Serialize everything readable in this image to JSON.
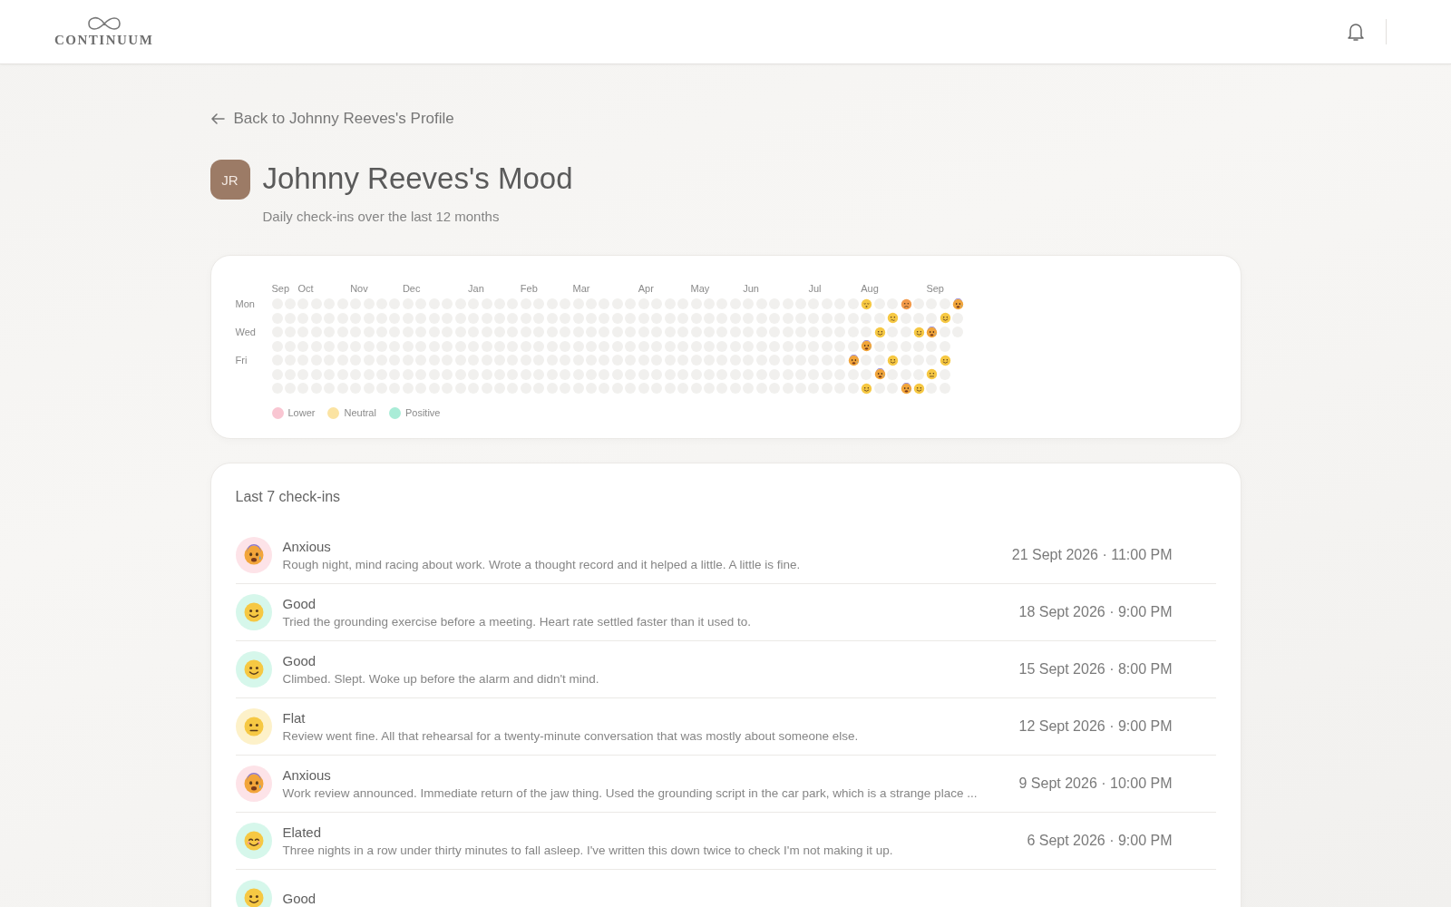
{
  "header": {
    "logo": "CONTINUUM"
  },
  "back_link": "Back to Johnny Reeves's Profile",
  "profile": {
    "initials": "JR",
    "title": "Johnny Reeves's Mood",
    "subtitle": "Daily check-ins over the last 12 months"
  },
  "heatmap": {
    "day_labels": [
      {
        "kind": "label",
        "label": "Mon"
      },
      {
        "kind": "blank"
      },
      {
        "kind": "label",
        "label": "Wed"
      },
      {
        "kind": "blank"
      },
      {
        "kind": "label",
        "label": "Fri"
      },
      {
        "kind": "blank"
      },
      {
        "kind": "blank"
      }
    ],
    "weeks": [
      {
        "kind": "blank",
        "month": "Sep"
      },
      {
        "kind": "blank"
      },
      {
        "kind": "blank",
        "month": "Oct"
      },
      {
        "kind": "blank"
      },
      {
        "kind": "blank"
      },
      {
        "kind": "blank"
      },
      {
        "kind": "blank",
        "month": "Nov"
      },
      {
        "kind": "blank"
      },
      {
        "kind": "blank"
      },
      {
        "kind": "blank"
      },
      {
        "kind": "blank",
        "month": "Dec"
      },
      {
        "kind": "blank"
      },
      {
        "kind": "blank"
      },
      {
        "kind": "blank"
      },
      {
        "kind": "blank"
      },
      {
        "kind": "blank",
        "month": "Jan"
      },
      {
        "kind": "blank"
      },
      {
        "kind": "blank"
      },
      {
        "kind": "blank"
      },
      {
        "kind": "blank",
        "month": "Feb"
      },
      {
        "kind": "blank"
      },
      {
        "kind": "blank"
      },
      {
        "kind": "blank"
      },
      {
        "kind": "blank",
        "month": "Mar"
      },
      {
        "kind": "blank"
      },
      {
        "kind": "blank"
      },
      {
        "kind": "blank"
      },
      {
        "kind": "blank"
      },
      {
        "kind": "blank",
        "month": "Apr"
      },
      {
        "kind": "blank"
      },
      {
        "kind": "blank"
      },
      {
        "kind": "blank"
      },
      {
        "kind": "blank",
        "month": "May"
      },
      {
        "kind": "blank"
      },
      {
        "kind": "blank"
      },
      {
        "kind": "blank"
      },
      {
        "kind": "blank",
        "month": "Jun"
      },
      {
        "kind": "blank"
      },
      {
        "kind": "blank"
      },
      {
        "kind": "blank"
      },
      {
        "kind": "blank"
      },
      {
        "kind": "blank",
        "month": "Jul"
      },
      {
        "kind": "blank"
      },
      {
        "kind": "blank"
      },
      {
        "kind": "days",
        "days": [
          {
            "kind": "empty"
          },
          {
            "kind": "empty"
          },
          {
            "kind": "empty"
          },
          {
            "kind": "empty"
          },
          {
            "kind": "anxious"
          },
          {
            "kind": "empty"
          },
          {
            "kind": "empty"
          }
        ]
      },
      {
        "kind": "days",
        "month": "Aug",
        "days": [
          {
            "kind": "tired"
          },
          {
            "kind": "empty"
          },
          {
            "kind": "empty"
          },
          {
            "kind": "anxious"
          },
          {
            "kind": "empty"
          },
          {
            "kind": "empty"
          },
          {
            "kind": "good"
          }
        ]
      },
      {
        "kind": "days",
        "days": [
          {
            "kind": "empty"
          },
          {
            "kind": "empty"
          },
          {
            "kind": "good"
          },
          {
            "kind": "empty"
          },
          {
            "kind": "empty"
          },
          {
            "kind": "anxious"
          },
          {
            "kind": "empty"
          }
        ]
      },
      {
        "kind": "days",
        "days": [
          {
            "kind": "empty"
          },
          {
            "kind": "uneasy"
          },
          {
            "kind": "empty"
          },
          {
            "kind": "empty"
          },
          {
            "kind": "good"
          },
          {
            "kind": "empty"
          },
          {
            "kind": "empty"
          }
        ]
      },
      {
        "kind": "days",
        "days": [
          {
            "kind": "upset"
          },
          {
            "kind": "empty"
          },
          {
            "kind": "empty"
          },
          {
            "kind": "empty"
          },
          {
            "kind": "empty"
          },
          {
            "kind": "empty"
          },
          {
            "kind": "anxious"
          }
        ]
      },
      {
        "kind": "days",
        "days": [
          {
            "kind": "empty"
          },
          {
            "kind": "empty"
          },
          {
            "kind": "good"
          },
          {
            "kind": "empty"
          },
          {
            "kind": "empty"
          },
          {
            "kind": "empty"
          },
          {
            "kind": "good"
          }
        ]
      },
      {
        "kind": "days",
        "month": "Sep",
        "days": [
          {
            "kind": "empty"
          },
          {
            "kind": "empty"
          },
          {
            "kind": "anxious"
          },
          {
            "kind": "empty"
          },
          {
            "kind": "empty"
          },
          {
            "kind": "flat"
          },
          {
            "kind": "empty"
          }
        ]
      },
      {
        "kind": "days",
        "days": [
          {
            "kind": "empty"
          },
          {
            "kind": "good"
          },
          {
            "kind": "empty"
          },
          {
            "kind": "empty"
          },
          {
            "kind": "good"
          },
          {
            "kind": "empty"
          },
          {
            "kind": "empty"
          }
        ]
      },
      {
        "kind": "days",
        "days": [
          {
            "kind": "anxious"
          },
          {
            "kind": "empty"
          },
          {
            "kind": "empty"
          }
        ]
      }
    ],
    "legend": [
      {
        "label": "Lower",
        "color": "#f9c6d2"
      },
      {
        "label": "Neutral",
        "color": "#fbe3a2"
      },
      {
        "label": "Positive",
        "color": "#a9ecd7"
      }
    ]
  },
  "checkins": {
    "title": "Last 7 check-ins",
    "items": [
      {
        "kind": "anxious",
        "color": "#fde3e8",
        "mood": "Anxious",
        "note": "Rough night, mind racing about work. Wrote a thought record and it helped a little. A little is fine.",
        "date": "21 Sept 2026 · 11:00 PM"
      },
      {
        "kind": "good",
        "color": "#d6f7eb",
        "mood": "Good",
        "note": "Tried the grounding exercise before a meeting. Heart rate settled faster than it used to.",
        "date": "18 Sept 2026 · 9:00 PM"
      },
      {
        "kind": "good",
        "color": "#d6f7eb",
        "mood": "Good",
        "note": "Climbed. Slept. Woke up before the alarm and didn't mind.",
        "date": "15 Sept 2026 · 8:00 PM"
      },
      {
        "kind": "flat",
        "color": "#fdf1c9",
        "mood": "Flat",
        "note": "Review went fine. All that rehearsal for a twenty-minute conversation that was mostly about someone else.",
        "date": "12 Sept 2026 · 9:00 PM"
      },
      {
        "kind": "anxious",
        "color": "#fde3e8",
        "mood": "Anxious",
        "note": "Work review announced. Immediate return of the jaw thing. Used the grounding script in the car park, which is a strange place ...",
        "date": "9 Sept 2026 · 10:00 PM"
      },
      {
        "kind": "elated",
        "color": "#d6f7eb",
        "mood": "Elated",
        "note": "Three nights in a row under thirty minutes to fall asleep. I've written this down twice to check I'm not making it up.",
        "date": "6 Sept 2026 · 9:00 PM"
      },
      {
        "kind": "good",
        "color": "#d6f7eb",
        "mood": "Good"
      }
    ]
  }
}
